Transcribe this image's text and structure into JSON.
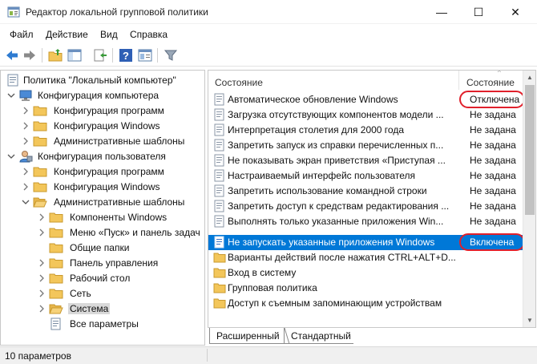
{
  "window": {
    "title": "Редактор локальной групповой политики",
    "minimize_glyph": "—",
    "maximize_glyph": "☐",
    "close_glyph": "✕"
  },
  "menu": {
    "file": "Файл",
    "action": "Действие",
    "view": "Вид",
    "help": "Справка"
  },
  "toolbar_icons": [
    "back-icon",
    "forward-icon",
    "up-folder-icon",
    "show-hide-tree-icon",
    "export-list-icon",
    "help-icon",
    "properties-icon",
    "filter-icon"
  ],
  "tree": {
    "root": "Политика \"Локальный компьютер\"",
    "computer_config": "Конфигурация компьютера",
    "cc_software": "Конфигурация программ",
    "cc_windows": "Конфигурация Windows",
    "cc_admin": "Административные шаблоны",
    "user_config": "Конфигурация пользователя",
    "uc_software": "Конфигурация программ",
    "uc_windows": "Конфигурация Windows",
    "uc_admin": "Административные шаблоны",
    "windows_components": "Компоненты Windows",
    "start_menu": "Меню «Пуск» и панель задач",
    "shared_folders": "Общие папки",
    "control_panel": "Панель управления",
    "desktop": "Рабочий стол",
    "network": "Сеть",
    "system": "Система",
    "all_settings": "Все параметры"
  },
  "list": {
    "col_name": "Состояние",
    "col_state": "Состояние",
    "rows": [
      {
        "name": "Автоматическое обновление Windows",
        "state": "Отключена"
      },
      {
        "name": "Загрузка отсутствующих компонентов модели ...",
        "state": "Не задана"
      },
      {
        "name": "Интерпретация столетия для 2000 года",
        "state": "Не задана"
      },
      {
        "name": "Запретить запуск из справки перечисленных п...",
        "state": "Не задана"
      },
      {
        "name": "Не показывать экран приветствия «Приступая ...",
        "state": "Не задана"
      },
      {
        "name": "Настраиваемый интерфейс пользователя",
        "state": "Не задана"
      },
      {
        "name": "Запретить использование командной строки",
        "state": "Не задана"
      },
      {
        "name": "Запретить доступ к средствам редактирования ...",
        "state": "Не задана"
      },
      {
        "name": "Выполнять только указанные приложения Win...",
        "state": "Не задана"
      },
      {
        "name": "Не запускать указанные приложения Windows",
        "state": "Включена"
      },
      {
        "name": "Варианты действий после нажатия CTRL+ALT+D...",
        "state": ""
      },
      {
        "name": "Вход в систему",
        "state": ""
      },
      {
        "name": "Групповая политика",
        "state": ""
      },
      {
        "name": "Доступ к съемным запоминающим устройствам",
        "state": ""
      }
    ]
  },
  "tabs": {
    "extended": "Расширенный",
    "standard": "Стандартный"
  },
  "status": {
    "text": "10 параметров"
  },
  "colors": {
    "selection": "#0078d7",
    "highlight_ring": "#e0202b",
    "folder": "#f3c65a"
  }
}
